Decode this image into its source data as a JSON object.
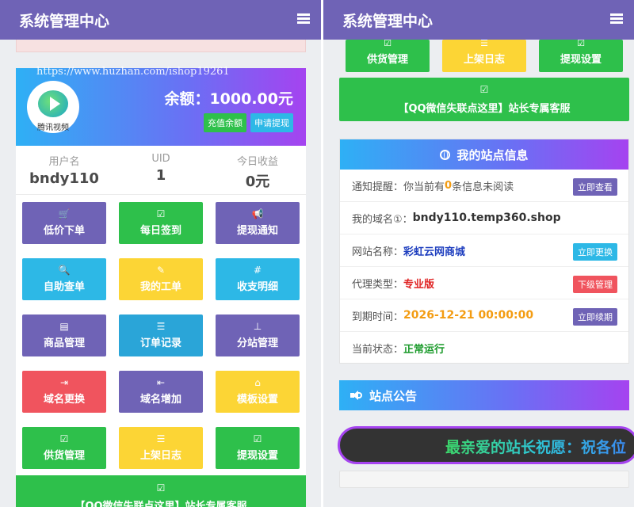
{
  "left": {
    "header": {
      "title": "系统管理中心"
    },
    "balance": {
      "avatar_caption": "腾讯视频",
      "watermark": "https://www.huzhan.com/ishop19261",
      "label": "余额：1000.00元",
      "recharge_label": "充值余额",
      "withdraw_label": "申请提现"
    },
    "stats": [
      {
        "label": "用户名",
        "value": "bndy110"
      },
      {
        "label": "UID",
        "value": "1"
      },
      {
        "label": "今日收益",
        "value": "0元"
      }
    ],
    "tiles": [
      {
        "label": "低价下单",
        "icon": "cart-icon",
        "glyph": "🛒",
        "color": "#6f63b6"
      },
      {
        "label": "每日签到",
        "icon": "check-square-icon",
        "glyph": "☑",
        "color": "#2ec04b"
      },
      {
        "label": "提现通知",
        "icon": "bullhorn-icon",
        "glyph": "📢",
        "color": "#6f63b6"
      },
      {
        "label": "自助查单",
        "icon": "search-icon",
        "glyph": "🔍",
        "color": "#2db8e6"
      },
      {
        "label": "我的工单",
        "icon": "edit-square-icon",
        "glyph": "✎",
        "color": "#fcd535"
      },
      {
        "label": "收支明细",
        "icon": "hash-icon",
        "glyph": "#",
        "color": "#2db8e6"
      },
      {
        "label": "商品管理",
        "icon": "list-alt-icon",
        "glyph": "▤",
        "color": "#6f63b6"
      },
      {
        "label": "订单记录",
        "icon": "list-icon",
        "glyph": "☰",
        "color": "#2aa5d8"
      },
      {
        "label": "分站管理",
        "icon": "sitemap-icon",
        "glyph": "⊥",
        "color": "#6f63b6"
      },
      {
        "label": "域名更换",
        "icon": "sign-out-icon",
        "glyph": "⇥",
        "color": "#f0545e"
      },
      {
        "label": "域名增加",
        "icon": "sign-in-icon",
        "glyph": "⇤",
        "color": "#6f63b6"
      },
      {
        "label": "模板设置",
        "icon": "home-icon",
        "glyph": "⌂",
        "color": "#fcd535"
      },
      {
        "label": "供货管理",
        "icon": "check-square-icon",
        "glyph": "☑",
        "color": "#2ec04b"
      },
      {
        "label": "上架日志",
        "icon": "list-icon",
        "glyph": "☰",
        "color": "#fcd535"
      },
      {
        "label": "提现设置",
        "icon": "check-square-icon",
        "glyph": "☑",
        "color": "#2ec04b"
      }
    ],
    "wide_button": {
      "icon": "check-square-icon",
      "glyph": "☑",
      "label": "【QQ微信失联点这里】站长专属客服"
    }
  },
  "right": {
    "header": {
      "title": "系统管理中心"
    },
    "tiles": [
      {
        "label": "供货管理",
        "icon": "check-square-icon",
        "glyph": "☑",
        "color": "#2ec04b"
      },
      {
        "label": "上架日志",
        "icon": "list-icon",
        "glyph": "☰",
        "color": "#fcd535"
      },
      {
        "label": "提现设置",
        "icon": "check-square-icon",
        "glyph": "☑",
        "color": "#2ec04b"
      }
    ],
    "wide_button": {
      "icon": "check-square-icon",
      "glyph": "☑",
      "label": "【QQ微信失联点这里】站长专属客服"
    },
    "site_info": {
      "title": "我的站点信息",
      "notice": {
        "label": "通知提醒：",
        "prefix": "你当前有",
        "count": "0",
        "suffix": "条信息未阅读",
        "button": "立即查看"
      },
      "domain": {
        "label": "我的域名①：",
        "value": "bndy110.temp360.shop"
      },
      "site_name": {
        "label": "网站名称：",
        "value": "彩虹云网商城",
        "button": "立即更换"
      },
      "agent_type": {
        "label": "代理类型：",
        "value": "专业版",
        "button": "下级管理"
      },
      "expire": {
        "label": "到期时间：",
        "value": "2026-12-21 00:00:00",
        "button": "立即续期"
      },
      "status": {
        "label": "当前状态：",
        "value": "正常运行"
      }
    },
    "announcement": {
      "title": "站点公告",
      "marquee_text": "最亲爱的站长祝愿：祝各位"
    }
  },
  "colors": {
    "header": "#6f63b6",
    "green": "#2ec04b",
    "purple": "#6f63b6",
    "cyan": "#2db8e6",
    "yellow": "#fcd535",
    "red": "#f0545e",
    "orange_value": "#f39c12",
    "blue_link": "#1f3fbf"
  }
}
